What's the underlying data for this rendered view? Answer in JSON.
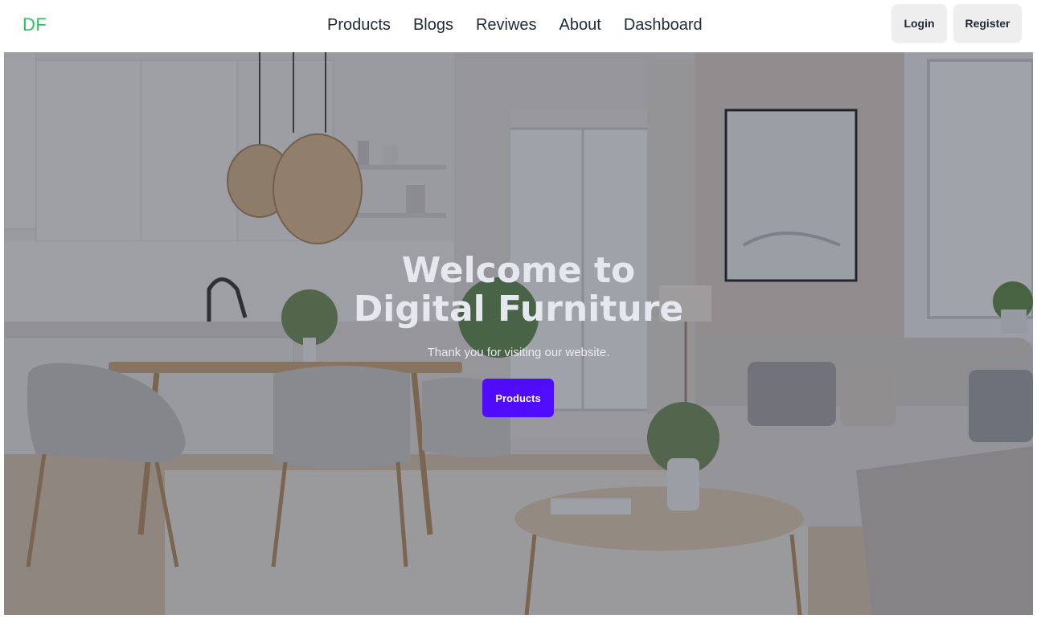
{
  "brand": {
    "name": "DF",
    "color": "#22c55e"
  },
  "nav": {
    "items": [
      {
        "label": "Products"
      },
      {
        "label": "Blogs"
      },
      {
        "label": "Reviwes"
      },
      {
        "label": "About"
      },
      {
        "label": "Dashboard"
      }
    ]
  },
  "auth": {
    "login_label": "Login",
    "register_label": "Register"
  },
  "hero": {
    "title_line1": "Welcome to",
    "title_line2": "Digital Furniture",
    "subtitle": "Thank you for visiting our website.",
    "cta_label": "Products",
    "cta_color": "#4f0cff"
  }
}
